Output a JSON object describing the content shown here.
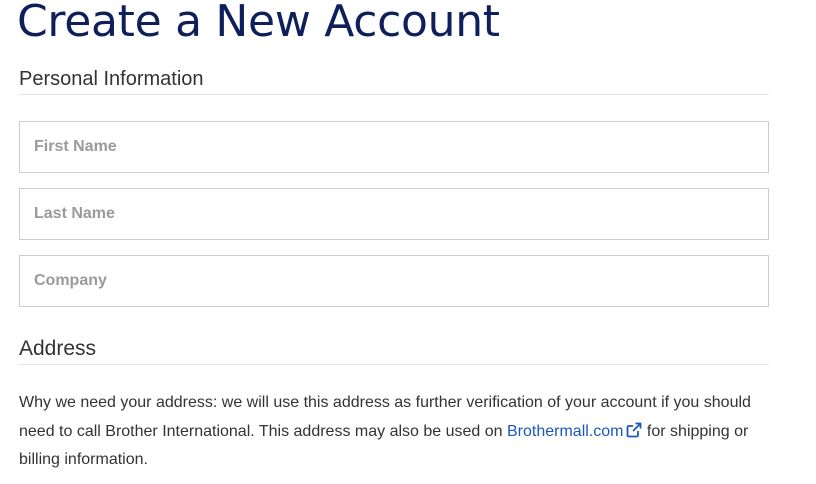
{
  "page": {
    "title": "Create a New Account"
  },
  "personal": {
    "heading": "Personal Information",
    "fields": {
      "first_name": {
        "placeholder": "First Name",
        "value": ""
      },
      "last_name": {
        "placeholder": "Last Name",
        "value": ""
      },
      "company": {
        "placeholder": "Company",
        "value": ""
      }
    }
  },
  "address": {
    "heading": "Address",
    "note": {
      "before_link": "Why we need your address: we will use this address as further verification of your account if you should need to call Brother International. This address may also be used on ",
      "link_text": "Brothermall.com",
      "link_icon": "external-link-icon",
      "after_link": " for shipping or billing information."
    }
  },
  "colors": {
    "title": "#0e1f5b",
    "link": "#1b58b8",
    "text": "#333333",
    "placeholder": "#9a9a9a",
    "border": "#cccccc",
    "divider": "#e3e3e3"
  }
}
